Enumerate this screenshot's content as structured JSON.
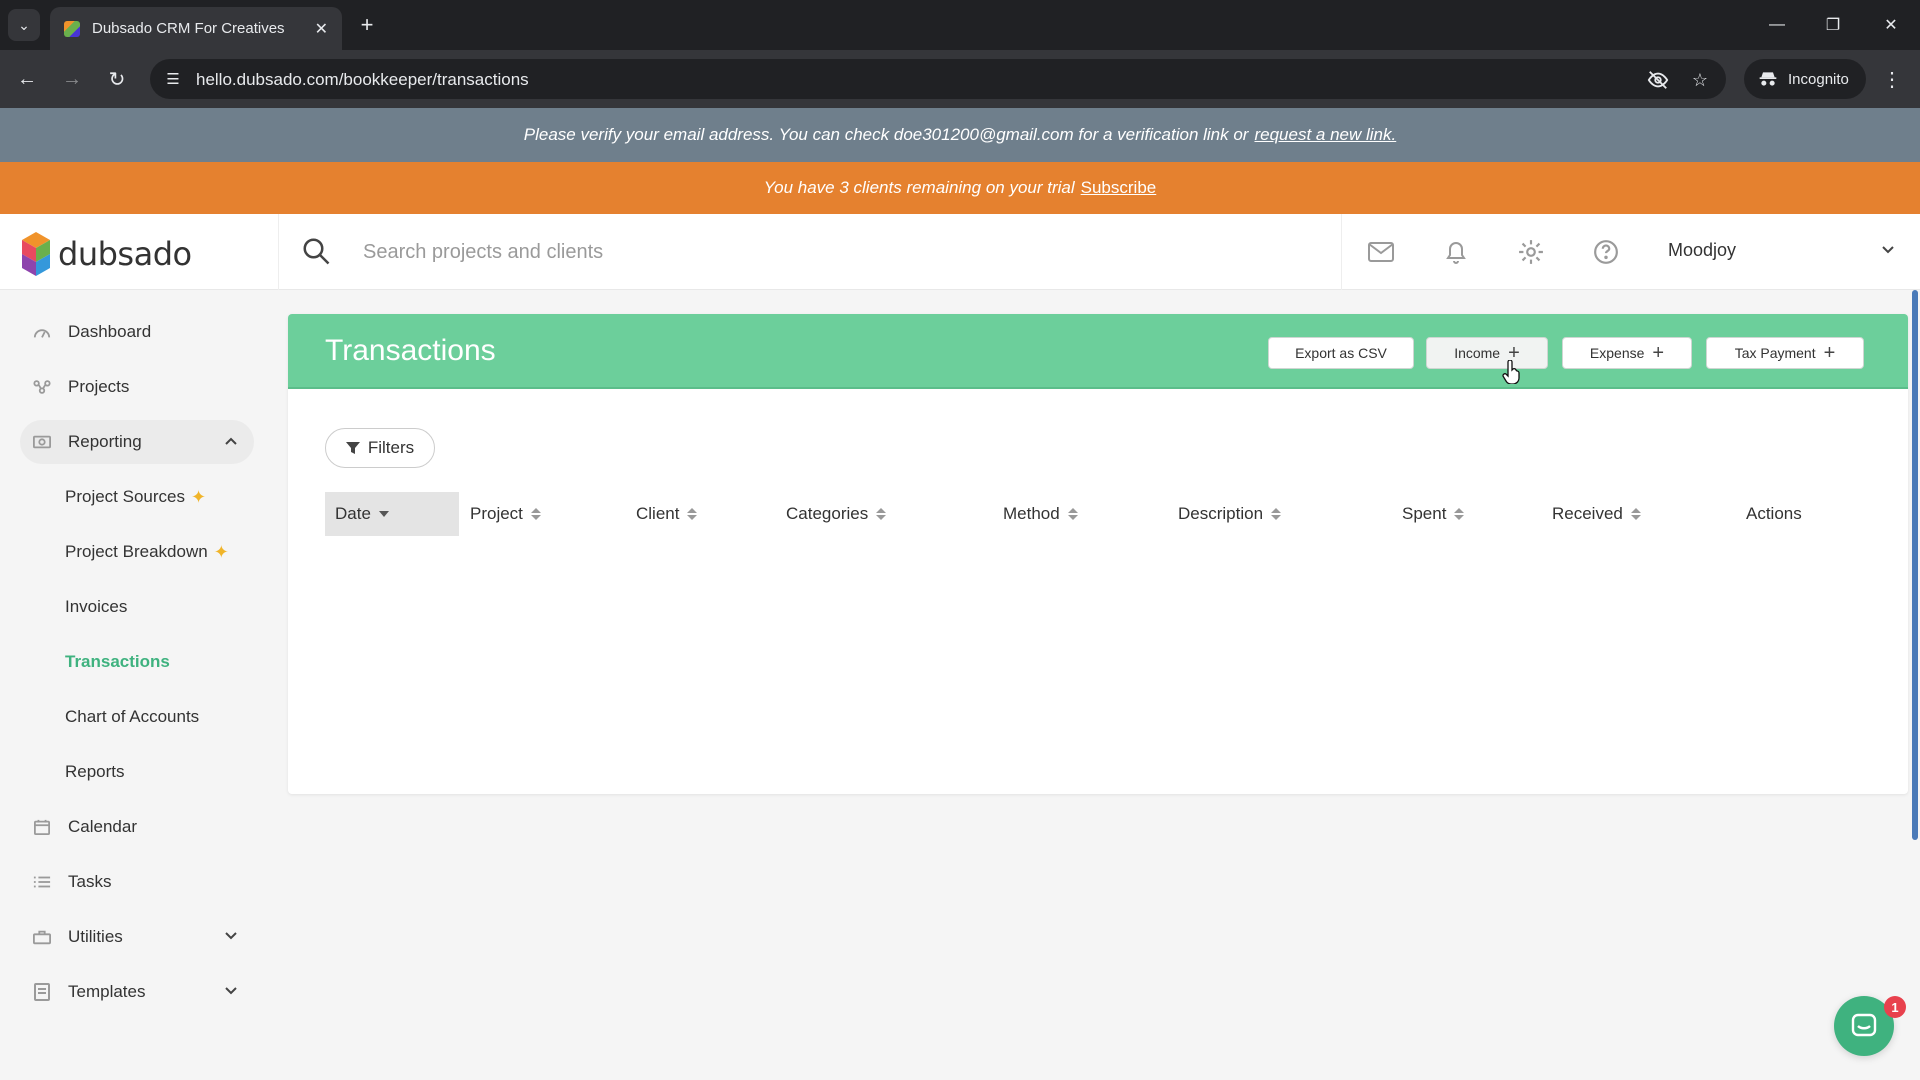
{
  "browser": {
    "tab_title": "Dubsado CRM For Creatives",
    "url": "hello.dubsado.com/bookkeeper/transactions",
    "incognito_label": "Incognito"
  },
  "banners": {
    "verify_text": "Please verify your email address. You can check doe301200@gmail.com for a verification link or",
    "verify_link": "request a new link.",
    "trial_text": "You have 3 clients remaining on your trial",
    "trial_link": "Subscribe"
  },
  "header": {
    "logo_text": "dubsado",
    "search_placeholder": "Search projects and clients",
    "user_name": "Moodjoy"
  },
  "sidebar": {
    "items": [
      {
        "label": "Dashboard",
        "icon": "dashboard-icon"
      },
      {
        "label": "Projects",
        "icon": "projects-icon"
      },
      {
        "label": "Reporting",
        "icon": "reporting-icon",
        "expanded": true
      },
      {
        "label": "Calendar",
        "icon": "calendar-icon"
      },
      {
        "label": "Tasks",
        "icon": "tasks-icon"
      },
      {
        "label": "Utilities",
        "icon": "utilities-icon"
      },
      {
        "label": "Templates",
        "icon": "templates-icon"
      }
    ],
    "reporting_children": [
      {
        "label": "Project Sources",
        "new": true
      },
      {
        "label": "Project Breakdown",
        "new": true
      },
      {
        "label": "Invoices"
      },
      {
        "label": "Transactions",
        "current": true
      },
      {
        "label": "Chart of Accounts"
      },
      {
        "label": "Reports"
      }
    ]
  },
  "main": {
    "title": "Transactions",
    "buttons": {
      "export": "Export as CSV",
      "income": "Income",
      "expense": "Expense",
      "tax": "Tax Payment"
    },
    "filters_label": "Filters",
    "columns": [
      "Date",
      "Project",
      "Client",
      "Categories",
      "Method",
      "Description",
      "Spent",
      "Received",
      "Actions"
    ]
  },
  "chat": {
    "badge_count": "1"
  },
  "colors": {
    "brand_green": "#6ccf9b",
    "active_green": "#3fb27f",
    "trial_orange": "#e5812f",
    "verify_slate": "#6f7f8c"
  }
}
